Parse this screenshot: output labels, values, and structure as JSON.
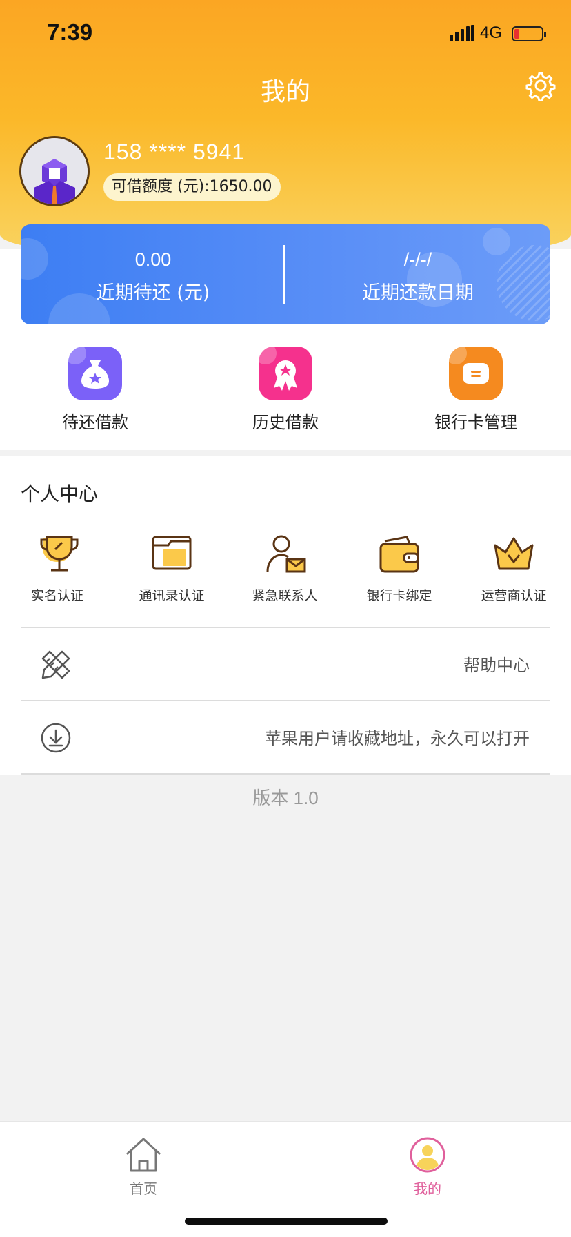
{
  "status_bar": {
    "time": "7:39",
    "network": "4G"
  },
  "header": {
    "title": "我的"
  },
  "user": {
    "phone": "158 **** 5941",
    "credit_limit": "可借额度 (元):1650.00"
  },
  "loan_summary": {
    "pending_amount": "0.00",
    "pending_label": "近期待还 (元)",
    "due_date": "/-/-/",
    "due_date_label": "近期还款日期"
  },
  "quick_actions": [
    {
      "label": "待还借款",
      "icon": "money-bag-icon",
      "color": "#7b61f8"
    },
    {
      "label": "历史借款",
      "icon": "award-ribbon-icon",
      "color": "#f5318d"
    },
    {
      "label": "银行卡管理",
      "icon": "card-manage-icon",
      "color": "#f58a1f"
    }
  ],
  "personal_center": {
    "title": "个人中心",
    "certifications": [
      {
        "label": "实名认证",
        "icon": "trophy-icon"
      },
      {
        "label": "通讯录认证",
        "icon": "folder-icon"
      },
      {
        "label": "紧急联系人",
        "icon": "contact-mail-icon"
      },
      {
        "label": "银行卡绑定",
        "icon": "wallet-icon"
      },
      {
        "label": "运营商认证",
        "icon": "crown-icon"
      }
    ]
  },
  "menu_rows": [
    {
      "label": "帮助中心",
      "icon": "pencil-ruler-icon"
    },
    {
      "label": "苹果用户请收藏地址，永久可以打开",
      "icon": "download-icon"
    }
  ],
  "version": "版本 1.0",
  "tab_bar": {
    "items": [
      {
        "label": "首页",
        "icon": "home-icon",
        "active": false
      },
      {
        "label": "我的",
        "icon": "user-profile-icon",
        "active": true
      }
    ],
    "active_color": "#e0609c",
    "inactive_color": "#777777"
  }
}
